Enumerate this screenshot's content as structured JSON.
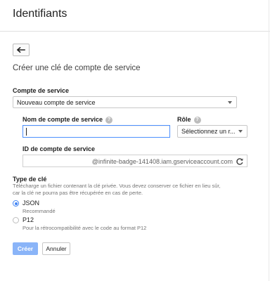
{
  "header": {
    "title": "Identifiants"
  },
  "form": {
    "subtitle": "Créer une clé de compte de service",
    "service_account": {
      "label": "Compte de service",
      "selected": "Nouveau compte de service"
    },
    "account_name": {
      "label": "Nom de compte de service",
      "help": "?",
      "value": ""
    },
    "role": {
      "label": "Rôle",
      "help": "?",
      "selected": "Sélectionnez un r..."
    },
    "account_id": {
      "label": "ID de compte de service",
      "value": "@infinite-badge-141408.iam.gserviceaccount.com"
    },
    "key_type": {
      "label": "Type de clé",
      "description_line1": "Télécharge un fichier contenant la clé privée. Vous devez conserver ce fichier en lieu sûr,",
      "description_line2": "car la clé ne pourra pas être récupérée en cas de perte.",
      "options": [
        {
          "label": "JSON",
          "hint": "Recommandé",
          "selected": true
        },
        {
          "label": "P12",
          "hint": "Pour la rétrocompatibilité avec le code au format P12",
          "selected": false
        }
      ]
    },
    "actions": {
      "create_label": "Créer",
      "cancel_label": "Annuler"
    }
  },
  "colors": {
    "accent": "#4285f4",
    "primary_button": "#8ab4f8",
    "focus_border": "#4d90fe"
  },
  "icons": {
    "back": "arrow-left-icon",
    "refresh": "refresh-icon",
    "help": "help-circle-icon",
    "dropdown": "caret-down-icon"
  }
}
